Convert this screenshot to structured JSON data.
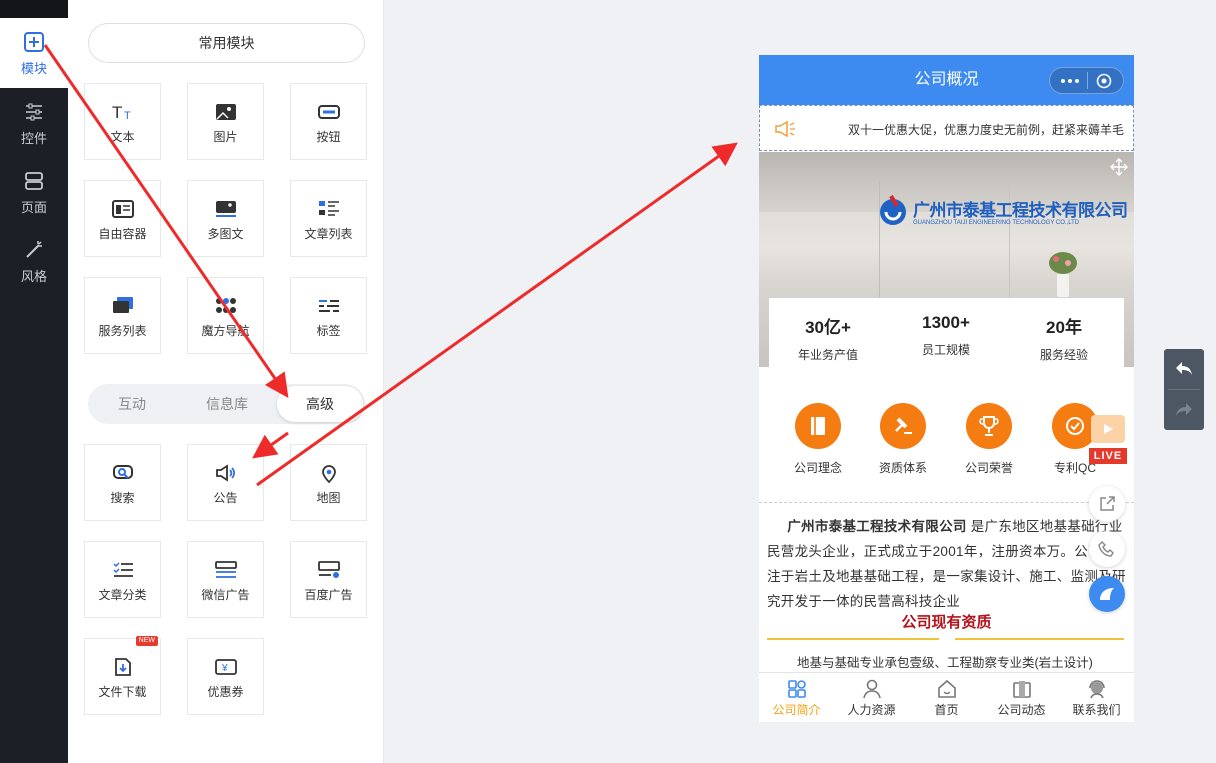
{
  "rail": {
    "items": [
      {
        "label": "模块",
        "icon": "plus-square-icon"
      },
      {
        "label": "控件",
        "icon": "sliders-icon"
      },
      {
        "label": "页面",
        "icon": "pages-icon"
      },
      {
        "label": "风格",
        "icon": "magic-wand-icon"
      }
    ]
  },
  "panel": {
    "common_label": "常用模块",
    "tiles_top": [
      {
        "label": "文本",
        "icon": "text-icon"
      },
      {
        "label": "图片",
        "icon": "image-icon"
      },
      {
        "label": "按钮",
        "icon": "button-icon"
      },
      {
        "label": "自由容器",
        "icon": "container-icon"
      },
      {
        "label": "多图文",
        "icon": "multi-image-icon"
      },
      {
        "label": "文章列表",
        "icon": "article-list-icon"
      },
      {
        "label": "服务列表",
        "icon": "service-list-icon"
      },
      {
        "label": "魔方导航",
        "icon": "grid-nav-icon"
      },
      {
        "label": "标签",
        "icon": "tag-icon"
      }
    ],
    "tabs": [
      "互动",
      "信息库",
      "高级"
    ],
    "active_tab": "高级",
    "tiles_adv": [
      {
        "label": "搜索",
        "icon": "search-icon"
      },
      {
        "label": "公告",
        "icon": "megaphone-icon"
      },
      {
        "label": "地图",
        "icon": "map-pin-icon"
      },
      {
        "label": "文章分类",
        "icon": "category-icon"
      },
      {
        "label": "微信广告",
        "icon": "wechat-ad-icon"
      },
      {
        "label": "百度广告",
        "icon": "baidu-ad-icon"
      },
      {
        "label": "文件下载",
        "icon": "download-icon"
      },
      {
        "label": "优惠券",
        "icon": "coupon-icon"
      }
    ],
    "new_badge": "NEW"
  },
  "phone": {
    "title": "公司概况",
    "notice": "双十一优惠大促，优惠力度史无前例，赶紧来薅羊毛",
    "banner_company": "广州市泰基工程技术有限公司",
    "banner_company_en": "GUANGZHOU TAIJI ENGINEERING TECHNOLOGY CO.,LTD",
    "stats": [
      {
        "value": "30亿+",
        "label": "年业务产值"
      },
      {
        "value": "1300+",
        "label": "员工规模"
      },
      {
        "value": "20年",
        "label": "服务经验"
      }
    ],
    "features": [
      "公司理念",
      "资质体系",
      "公司荣誉",
      "专利QC"
    ],
    "intro_company": "广州市泰基工程技术有限公司",
    "intro_rest": " 是广东地区地基基础行业民营龙头企业，正式成立于2001年，注册资本万。公司专注于岩土及地基基础工程，是一家集设计、施工、监测及研究开发于一体的民营高科技企业",
    "section_title": "公司现有资质",
    "qual_text": "地基与基础专业承包壹级、工程勘察专业类(岩土设计)",
    "live_label": "LIVE",
    "tabbar": [
      {
        "label": "公司简介",
        "icon": "grid-icon",
        "active": true
      },
      {
        "label": "人力资源",
        "icon": "user-icon",
        "active": false
      },
      {
        "label": "首页",
        "icon": "home-icon",
        "active": false
      },
      {
        "label": "公司动态",
        "icon": "news-icon",
        "active": false
      },
      {
        "label": "联系我们",
        "icon": "support-icon",
        "active": false
      }
    ]
  },
  "colors": {
    "accent": "#2f6fe4",
    "orange": "#f47c10",
    "header": "#3d8af0",
    "arrow": "#ee2a2a"
  }
}
